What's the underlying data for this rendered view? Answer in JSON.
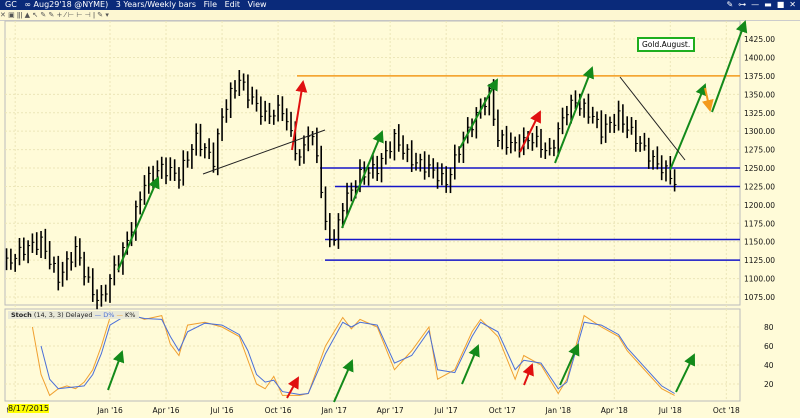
{
  "window": {
    "symbol": "GC",
    "contract": "∞ Aug29'18 @NYME)",
    "period": "3 Years/Weekly bars",
    "menu": [
      "File",
      "Edit",
      "View"
    ],
    "controls": [
      "✎",
      "⊶",
      "—",
      "▬",
      "■",
      "✕"
    ]
  },
  "toolbar": {
    "icons": "✕ ▣ ǁǀ ▲ ↖ ✎ ✎ + ⁄ ⊢ ⊢ ⊣ ǀ ✎ ▾"
  },
  "annotation": "Gold.August.",
  "stoch": {
    "label": "Stoch",
    "params": "(14, 3, 3) Delayed",
    "d_label": "D%",
    "k_label": "K%",
    "d_color": "#4a6fd8",
    "k_color": "#f0a030"
  },
  "date_box": "8/17/2015",
  "chart_data": {
    "type": "ohlc-weekly",
    "title": "GC Aug29'18 3 Years/Weekly bars",
    "ylim": [
      1060,
      1445
    ],
    "yticks": [
      1075,
      1100,
      1125,
      1150,
      1175,
      1200,
      1225,
      1250,
      1275,
      1300,
      1325,
      1350,
      1375,
      1400,
      1425
    ],
    "ytick_labels": [
      "1075.00",
      "1100.00",
      "1125.00",
      "1150.00",
      "1175.00",
      "1200.00",
      "1225.00",
      "1250.00",
      "1275.00",
      "1300.00",
      "1325.00",
      "1350.00",
      "1375.00",
      "1400.00",
      "1425.00"
    ],
    "xtick_labels": [
      "t '15",
      "Jan '16",
      "Apr '16",
      "Jul '16",
      "Oct '16",
      "Jan '17",
      "Apr '17",
      "Jul '17",
      "Oct '17",
      "Jan '18",
      "Apr '18",
      "Jul '18",
      "Oct '18"
    ],
    "xtick_weeks": [
      -22,
      0,
      13,
      26,
      39,
      52,
      65,
      78,
      91,
      104,
      117,
      130,
      143
    ],
    "price_anchors": [
      [
        -24,
        1120
      ],
      [
        -20,
        1140
      ],
      [
        -16,
        1150
      ],
      [
        -12,
        1100
      ],
      [
        -8,
        1140
      ],
      [
        -4,
        1080
      ],
      [
        -2,
        1070
      ],
      [
        0,
        1100
      ],
      [
        4,
        1150
      ],
      [
        8,
        1230
      ],
      [
        12,
        1250
      ],
      [
        16,
        1240
      ],
      [
        20,
        1290
      ],
      [
        24,
        1260
      ],
      [
        26,
        1320
      ],
      [
        28,
        1350
      ],
      [
        30,
        1370
      ],
      [
        32,
        1350
      ],
      [
        36,
        1320
      ],
      [
        40,
        1330
      ],
      [
        44,
        1260
      ],
      [
        46,
        1300
      ],
      [
        48,
        1270
      ],
      [
        50,
        1170
      ],
      [
        52,
        1150
      ],
      [
        54,
        1200
      ],
      [
        58,
        1240
      ],
      [
        62,
        1250
      ],
      [
        66,
        1290
      ],
      [
        70,
        1260
      ],
      [
        74,
        1250
      ],
      [
        78,
        1230
      ],
      [
        82,
        1290
      ],
      [
        86,
        1330
      ],
      [
        88,
        1350
      ],
      [
        90,
        1290
      ],
      [
        94,
        1280
      ],
      [
        98,
        1290
      ],
      [
        102,
        1270
      ],
      [
        106,
        1330
      ],
      [
        108,
        1340
      ],
      [
        112,
        1320
      ],
      [
        114,
        1300
      ],
      [
        118,
        1320
      ],
      [
        122,
        1290
      ],
      [
        126,
        1260
      ],
      [
        130,
        1240
      ],
      [
        131,
        1230
      ]
    ],
    "horizontal_levels": [
      {
        "price": 1375,
        "color": "#f39a1c"
      },
      {
        "price": 1250,
        "color": "#1515c8"
      },
      {
        "price": 1225,
        "color": "#1515c8"
      },
      {
        "price": 1153,
        "color": "#1515c8"
      },
      {
        "price": 1125,
        "color": "#1515c8"
      }
    ],
    "stoch_yticks": [
      20,
      40,
      60,
      80
    ],
    "stoch_k": [
      [
        -18,
        80
      ],
      [
        -16,
        30
      ],
      [
        -14,
        8
      ],
      [
        -12,
        15
      ],
      [
        -10,
        18
      ],
      [
        -8,
        15
      ],
      [
        -6,
        22
      ],
      [
        -4,
        35
      ],
      [
        -2,
        60
      ],
      [
        0,
        90
      ],
      [
        4,
        95
      ],
      [
        8,
        88
      ],
      [
        12,
        92
      ],
      [
        14,
        62
      ],
      [
        16,
        50
      ],
      [
        18,
        82
      ],
      [
        22,
        85
      ],
      [
        26,
        80
      ],
      [
        30,
        70
      ],
      [
        32,
        45
      ],
      [
        34,
        20
      ],
      [
        36,
        15
      ],
      [
        38,
        28
      ],
      [
        40,
        8
      ],
      [
        44,
        8
      ],
      [
        46,
        10
      ],
      [
        50,
        60
      ],
      [
        54,
        90
      ],
      [
        56,
        78
      ],
      [
        58,
        88
      ],
      [
        62,
        80
      ],
      [
        66,
        35
      ],
      [
        70,
        55
      ],
      [
        74,
        80
      ],
      [
        76,
        25
      ],
      [
        80,
        35
      ],
      [
        84,
        75
      ],
      [
        86,
        88
      ],
      [
        90,
        70
      ],
      [
        94,
        25
      ],
      [
        96,
        50
      ],
      [
        100,
        40
      ],
      [
        104,
        10
      ],
      [
        106,
        25
      ],
      [
        110,
        92
      ],
      [
        114,
        80
      ],
      [
        118,
        70
      ],
      [
        120,
        55
      ],
      [
        124,
        35
      ],
      [
        128,
        15
      ],
      [
        131,
        8
      ]
    ],
    "stoch_d": [
      [
        -16,
        60
      ],
      [
        -14,
        25
      ],
      [
        -12,
        15
      ],
      [
        -10,
        16
      ],
      [
        -8,
        17
      ],
      [
        -6,
        18
      ],
      [
        -4,
        30
      ],
      [
        -2,
        52
      ],
      [
        0,
        82
      ],
      [
        4,
        93
      ],
      [
        8,
        89
      ],
      [
        12,
        88
      ],
      [
        14,
        70
      ],
      [
        16,
        55
      ],
      [
        18,
        75
      ],
      [
        22,
        84
      ],
      [
        26,
        82
      ],
      [
        30,
        72
      ],
      [
        32,
        55
      ],
      [
        34,
        30
      ],
      [
        36,
        22
      ],
      [
        38,
        24
      ],
      [
        40,
        12
      ],
      [
        44,
        9
      ],
      [
        46,
        10
      ],
      [
        50,
        52
      ],
      [
        54,
        85
      ],
      [
        56,
        80
      ],
      [
        58,
        85
      ],
      [
        62,
        82
      ],
      [
        66,
        42
      ],
      [
        70,
        50
      ],
      [
        74,
        76
      ],
      [
        76,
        35
      ],
      [
        80,
        32
      ],
      [
        84,
        70
      ],
      [
        86,
        85
      ],
      [
        90,
        75
      ],
      [
        94,
        35
      ],
      [
        96,
        45
      ],
      [
        100,
        42
      ],
      [
        104,
        15
      ],
      [
        106,
        22
      ],
      [
        110,
        85
      ],
      [
        114,
        82
      ],
      [
        118,
        72
      ],
      [
        120,
        58
      ],
      [
        124,
        38
      ],
      [
        128,
        18
      ],
      [
        131,
        10
      ]
    ]
  }
}
